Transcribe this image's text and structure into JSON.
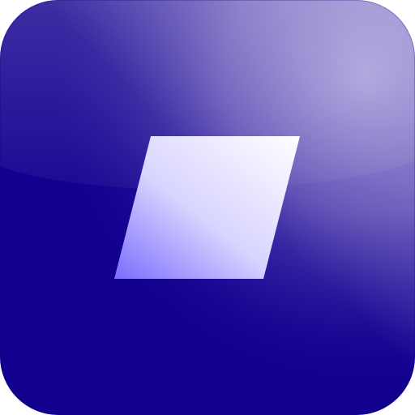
{
  "icon": {
    "name": "app-icon",
    "glyph": "parallelogram-logo",
    "colors": {
      "base": "#12008f",
      "base_light": "#8b7fc8",
      "highlight": "#ffffff",
      "glyph_top": "#ffffff",
      "glyph_bottom": "#7a6cff"
    }
  }
}
